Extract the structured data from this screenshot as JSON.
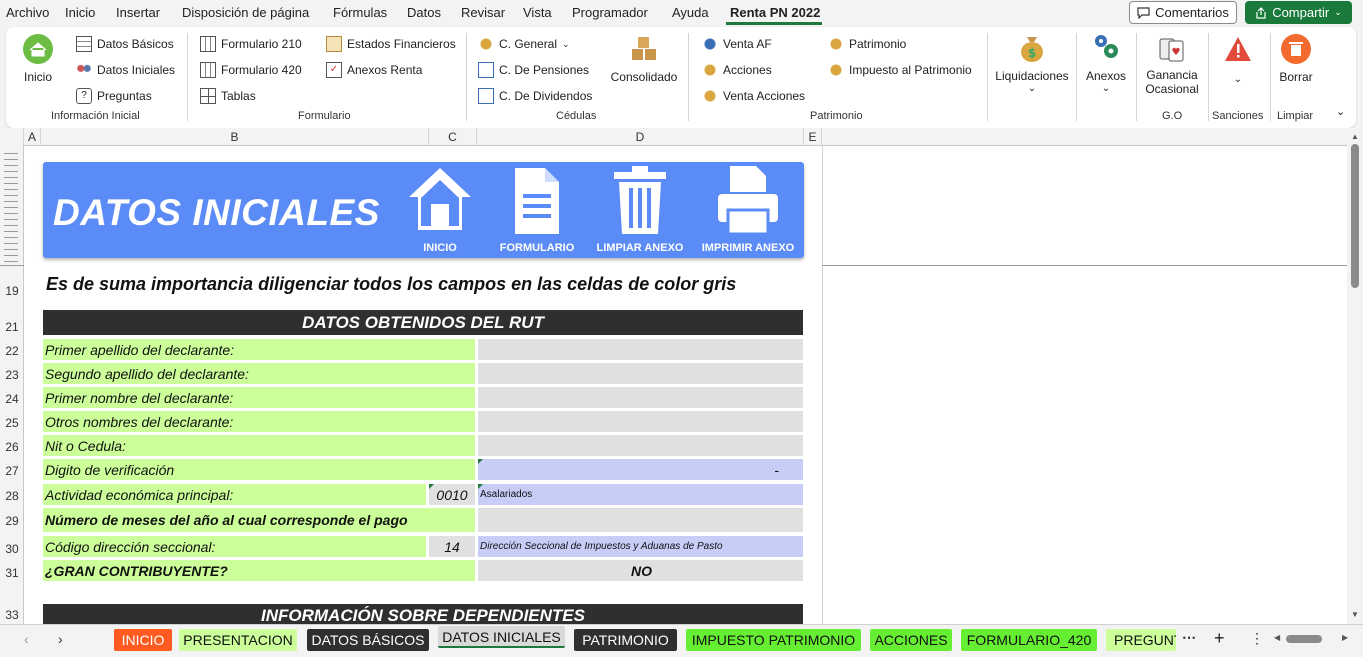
{
  "menu": {
    "items": [
      "Archivo",
      "Inicio",
      "Insertar",
      "Disposición de página",
      "Fórmulas",
      "Datos",
      "Revisar",
      "Vista",
      "Programador",
      "Ayuda",
      "Renta PN 2022"
    ],
    "comments_label": "Comentarios",
    "share_label": "Compartir"
  },
  "ribbon": {
    "inicio": "Inicio",
    "datos_basicos": "Datos Básicos",
    "datos_iniciales": "Datos Iniciales",
    "preguntas": "Preguntas",
    "group_info": "Información Inicial",
    "formulario_210": "Formulario 210",
    "formulario_420": "Formulario 420",
    "tablas": "Tablas",
    "estados_financieros": "Estados Financieros",
    "anexos_renta": "Anexos Renta",
    "group_formulario": "Formulario",
    "c_general": "C. General",
    "c_pensiones": "C. De Pensiones",
    "c_dividendos": "C. De Dividendos",
    "consolidado": "Consolidado",
    "group_cedulas": "Cédulas",
    "venta_af": "Venta AF",
    "acciones": "Acciones",
    "venta_acciones": "Venta Acciones",
    "patrimonio": "Patrimonio",
    "impuesto_patrimonio": "Impuesto al Patrimonio",
    "group_patrimonio": "Patrimonio",
    "liquidaciones": "Liquidaciones",
    "anexos": "Anexos",
    "ganancia": "Ganancia",
    "ocasional": "Ocasional",
    "group_go": "G.O",
    "group_sanciones": "Sanciones",
    "borrar": "Borrar",
    "group_limpiar": "Limpiar"
  },
  "columns": [
    "A",
    "B",
    "C",
    "D",
    "E"
  ],
  "rows": [
    "19",
    "21",
    "22",
    "23",
    "24",
    "25",
    "26",
    "27",
    "28",
    "29",
    "30",
    "31",
    "33"
  ],
  "banner": {
    "title": "DATOS INICIALES",
    "btn_inicio": "INICIO",
    "btn_formulario": "FORMULARIO",
    "btn_limpiar": "LIMPIAR ANEXO",
    "btn_imprimir": "IMPRIMIR ANEXO"
  },
  "notice": "Es de suma importancia diligenciar todos los campos en las celdas de color gris",
  "section_rut": "DATOS OBTENIDOS DEL RUT",
  "fields": {
    "primer_apellido": "Primer apellido del declarante:",
    "segundo_apellido": "Segundo apellido del declarante:",
    "primer_nombre": "Primer nombre del declarante:",
    "otros_nombres": "Otros nombres del declarante:",
    "nit": "Nit o Cedula:",
    "digito": "Digito de verificación",
    "digito_value": "-",
    "actividad": "Actividad económica principal:",
    "actividad_code": "0010",
    "actividad_desc": "Asalariados",
    "meses": "Número de meses del año al cual corresponde el pago",
    "codigo_dir": "Código dirección seccional:",
    "codigo_dir_value": "14",
    "codigo_dir_desc": "Dirección Seccional de Impuestos y Aduanas de Pasto",
    "gran_contribuyente": "¿GRAN CONTRIBUYENTE?",
    "gran_contribuyente_value": "NO"
  },
  "section_dependientes": "INFORMACIÓN SOBRE DEPENDIENTES",
  "tabs": [
    {
      "label": "INICIO",
      "bg": "#ff5a1f",
      "fg": "#ffffff"
    },
    {
      "label": "PRESENTACION",
      "bg": "#ccff99",
      "fg": "#111111"
    },
    {
      "label": "DATOS BÁSICOS",
      "bg": "#2f2f2f",
      "fg": "#ffffff"
    },
    {
      "label": "DATOS INICIALES",
      "bg": "#d9d9d9",
      "fg": "#111111"
    },
    {
      "label": "PATRIMONIO",
      "bg": "#2f2f2f",
      "fg": "#ffffff"
    },
    {
      "label": "IMPUESTO PATRIMONIO",
      "bg": "#66ee33",
      "fg": "#111111"
    },
    {
      "label": "ACCIONES",
      "bg": "#66ee33",
      "fg": "#111111"
    },
    {
      "label": "FORMULARIO_420",
      "bg": "#66ee33",
      "fg": "#111111"
    },
    {
      "label": "PREGUNT",
      "bg": "#ccff99",
      "fg": "#111111"
    }
  ]
}
